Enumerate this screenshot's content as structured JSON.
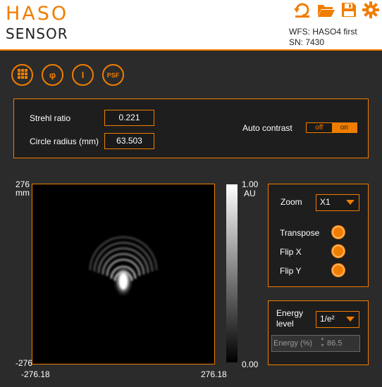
{
  "header": {
    "logo_line1": "HASO",
    "logo_line2": "SENSOR",
    "wfs_label": "WFS: HASO4 first",
    "sn_label": "SN: 7430",
    "icons": [
      "reset-icon",
      "open-folder-icon",
      "save-icon",
      "settings-gear-icon"
    ]
  },
  "tools": [
    {
      "name": "grid",
      "label": ""
    },
    {
      "name": "phi",
      "label": "φ"
    },
    {
      "name": "intensity",
      "label": "I"
    },
    {
      "name": "psf",
      "label": "PSF"
    }
  ],
  "strehl": {
    "strehl_label": "Strehl ratio",
    "strehl_value": "0.221",
    "radius_label": "Circle radius (mm)",
    "radius_value": "63.503",
    "auto_contrast_label": "Auto contrast",
    "toggle_off": "off",
    "toggle_on": "on",
    "auto_contrast_state": "on"
  },
  "plot": {
    "y_max": "276",
    "y_unit": "mm",
    "y_min": "-276",
    "x_min": "-276.18",
    "x_max": "276.18",
    "colorbar_max": "1.00",
    "colorbar_unit": "AU",
    "colorbar_min": "0.00"
  },
  "display": {
    "zoom_label": "Zoom",
    "zoom_value": "X1",
    "transpose_label": "Transpose",
    "flipx_label": "Flip X",
    "flipy_label": "Flip Y"
  },
  "energy": {
    "level_label_line1": "Energy",
    "level_label_line2": "level",
    "level_value": "1/e²",
    "percent_label": "Energy (%)",
    "percent_value": "86.5"
  },
  "colors": {
    "accent": "#f07d00",
    "background": "#2b2b2b",
    "panel": "#1e1e1e"
  }
}
